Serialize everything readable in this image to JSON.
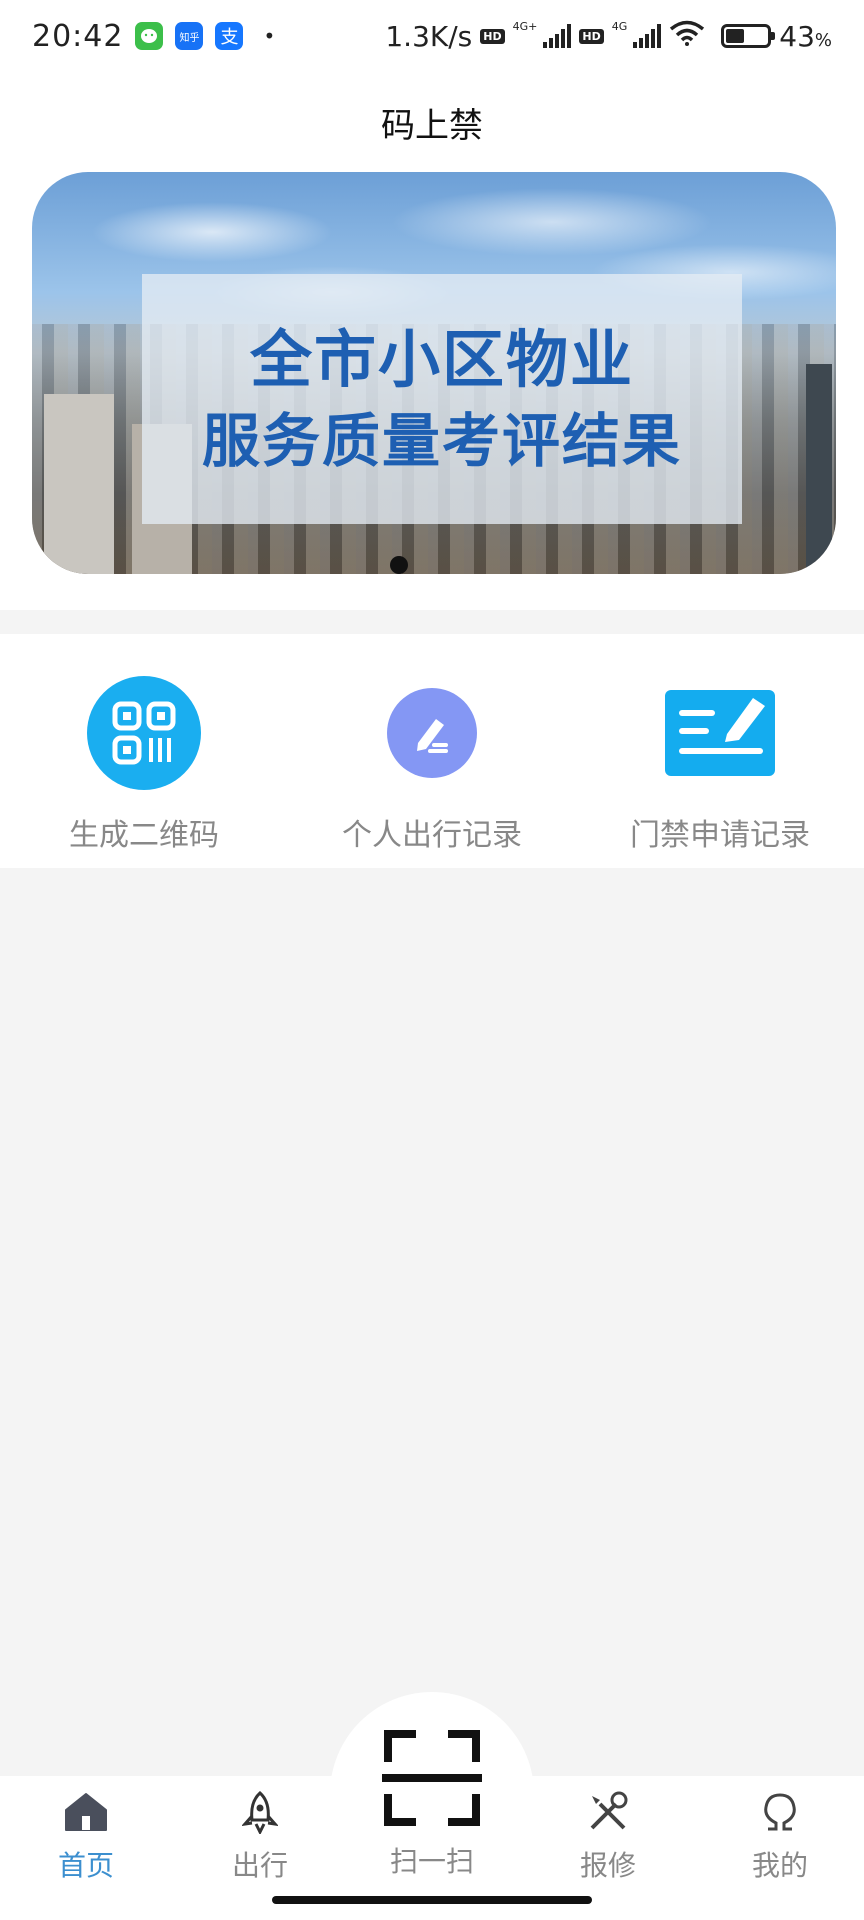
{
  "status_bar": {
    "time": "20:42",
    "apps": [
      "wechat-icon",
      "zhihu-icon",
      "alipay-icon"
    ],
    "zhihu_text": "知乎",
    "alipay_text": "支",
    "network_speed": "1.3K/s",
    "hd_label": "HD",
    "signal1_label": "4G+",
    "signal2_label": "4G",
    "battery_percent": "43",
    "battery_unit": "%"
  },
  "header": {
    "title": "码上禁"
  },
  "banner": {
    "line1": "全市小区物业",
    "line2": "服务质量考评结果",
    "page_count": 1,
    "active_page": 1
  },
  "shortcuts": [
    {
      "label": "生成二维码",
      "icon": "qr-code-icon",
      "color": "#1aaef0"
    },
    {
      "label": "个人出行记录",
      "icon": "pen-edit-icon",
      "color": "#8497f4"
    },
    {
      "label": "门禁申请记录",
      "icon": "sign-document-icon",
      "color": "#14acef"
    }
  ],
  "tabbar": {
    "active_color": "#3c8fcf",
    "inactive_color": "#888888",
    "tabs": [
      {
        "label": "首页",
        "icon": "home-icon",
        "active": true
      },
      {
        "label": "出行",
        "icon": "rocket-icon",
        "active": false
      },
      {
        "label": "扫一扫",
        "icon": "scan-icon",
        "active": false
      },
      {
        "label": "报修",
        "icon": "tools-icon",
        "active": false
      },
      {
        "label": "我的",
        "icon": "person-icon",
        "active": false
      }
    ]
  }
}
